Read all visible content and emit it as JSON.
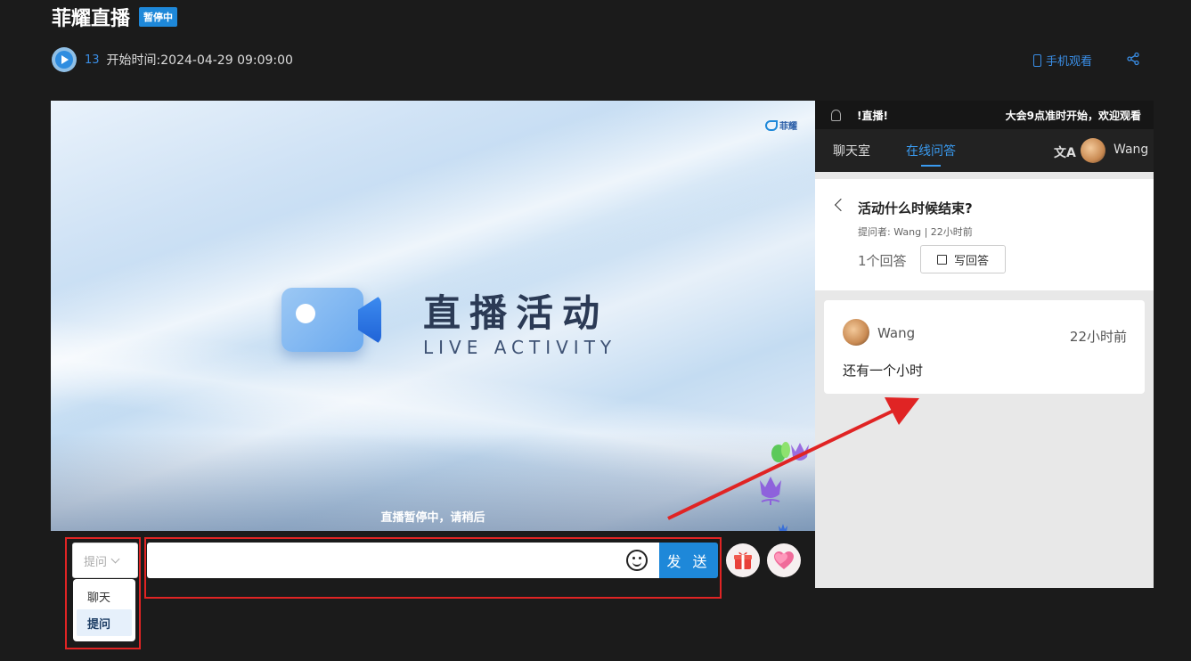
{
  "header": {
    "title": "菲耀直播",
    "status_badge": "暂停中",
    "viewer_count": "13",
    "start_time": "开始时间:2024-04-29 09:09:00",
    "mobile_watch": "手机观看",
    "share_icon": "share-icon"
  },
  "video": {
    "logo_text": "菲耀",
    "title": "直播活动",
    "subtitle": "LIVE ACTIVITY",
    "pause_message": "直播暂停中，请稍后"
  },
  "input_bar": {
    "mode_selected": "提问",
    "message_placeholder": "",
    "send_label": "发 送",
    "emoji_icon": "smile-icon",
    "gift_icon": "gift-icon",
    "like_icon": "heart-icon"
  },
  "mode_dropdown": {
    "options": [
      "聊天",
      "提问"
    ],
    "active": "提问"
  },
  "panel": {
    "notice_left": "!直播!",
    "notice_right": "大会9点准时开始，欢迎观看",
    "tabs": [
      {
        "label": "聊天室",
        "active": false
      },
      {
        "label": "在线问答",
        "active": true
      }
    ],
    "translate_icon": "translate-icon",
    "user_name": "Wang",
    "question": {
      "title": "活动什么时候结束?",
      "meta": "提问者: Wang | 22小时前",
      "answer_count": "1个回答",
      "write_answer": "写回答"
    },
    "answer": {
      "user": "Wang",
      "time": "22小时前",
      "text": "还有一个小时"
    }
  },
  "colors": {
    "accent": "#1e88d9",
    "annotation": "#e02424"
  }
}
